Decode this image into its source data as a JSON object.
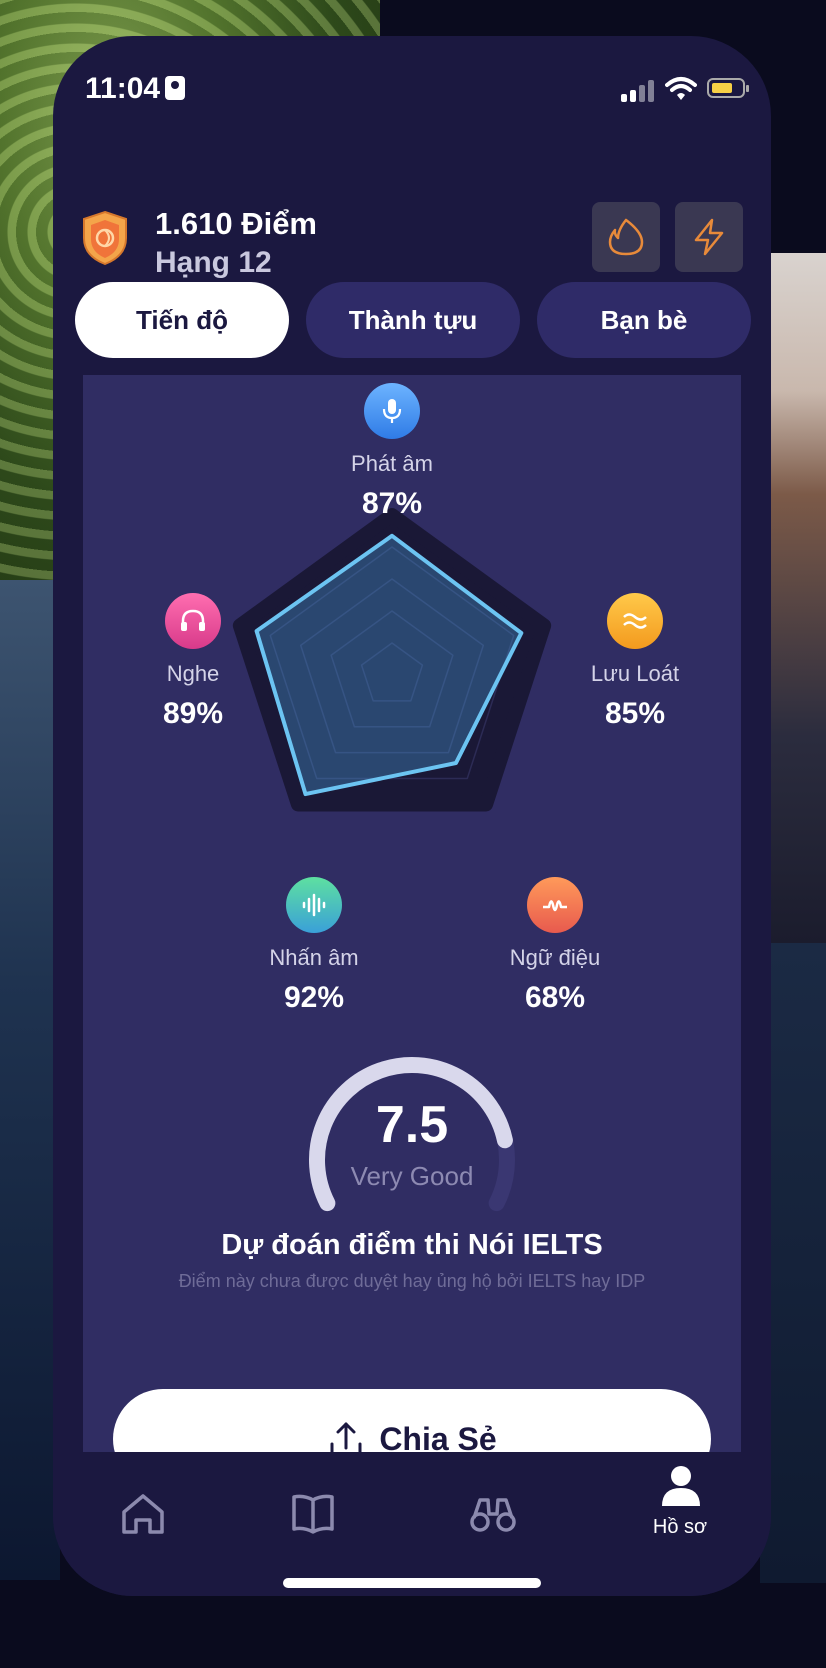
{
  "status": {
    "time": "11:04"
  },
  "header": {
    "points": "1.610 Điểm",
    "rank": "Hạng 12",
    "streak_icon": "flame-icon",
    "energy_icon": "bolt-icon"
  },
  "tabs": [
    {
      "label": "Tiến độ",
      "active": true
    },
    {
      "label": "Thành tựu",
      "active": false
    },
    {
      "label": "Bạn bè",
      "active": false
    }
  ],
  "skills": [
    {
      "name": "Phát âm",
      "percent": "87%",
      "value": 87,
      "icon": "microphone-icon",
      "color": "#3d8cf0"
    },
    {
      "name": "Lưu Loát",
      "percent": "85%",
      "value": 85,
      "icon": "wave-lines-icon",
      "color": "#f6a623"
    },
    {
      "name": "Ngữ điệu",
      "percent": "68%",
      "value": 68,
      "icon": "intonation-icon",
      "color": "#ee6a4a"
    },
    {
      "name": "Nhấn âm",
      "percent": "92%",
      "value": 92,
      "icon": "soundwave-icon",
      "color": "#38b6a8"
    },
    {
      "name": "Nghe",
      "percent": "89%",
      "value": 89,
      "icon": "headphones-icon",
      "color": "#e9488e"
    }
  ],
  "score": {
    "value": "7.5",
    "label": "Very Good",
    "max": 9
  },
  "prediction": {
    "title": "Dự đoán điểm thi Nói IELTS",
    "subtitle": "Điểm này chưa được duyệt hay ủng hộ bởi IELTS hay IDP"
  },
  "share": {
    "label": "Chia Sẻ"
  },
  "tabbar": {
    "items": [
      {
        "label": "",
        "icon": "home-icon"
      },
      {
        "label": "",
        "icon": "book-icon"
      },
      {
        "label": "",
        "icon": "binoculars-icon"
      },
      {
        "label": "Hồ sơ",
        "icon": "profile-icon",
        "active": true
      }
    ]
  }
}
